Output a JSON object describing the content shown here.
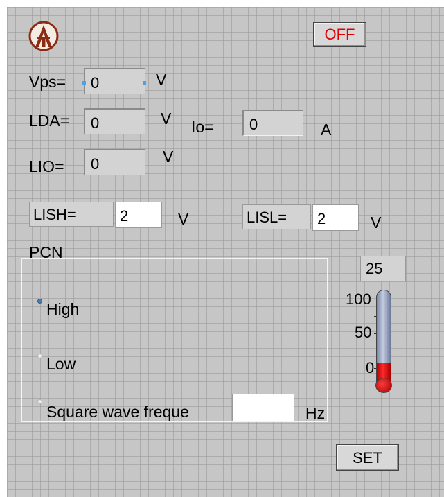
{
  "panel": {
    "power_button": "OFF",
    "vps": {
      "label": "Vps=",
      "value": "0",
      "unit": "V"
    },
    "lda": {
      "label": "LDA=",
      "value": "0",
      "unit": "V"
    },
    "io": {
      "label": "Io=",
      "value": "0",
      "unit": "A"
    },
    "lio": {
      "label": "LIO=",
      "value": "0",
      "unit": "V"
    },
    "lish": {
      "label": "LISH=",
      "value": "2",
      "unit": "V"
    },
    "lisl": {
      "label": "LISL=",
      "value": "2",
      "unit": "V"
    },
    "pcn": {
      "title": "PCN",
      "options": [
        "High",
        "Low",
        "Square wave freque"
      ],
      "selected": "High",
      "freq_value": "",
      "freq_unit": "Hz"
    },
    "thermometer": {
      "value_display": "25",
      "scale_labels": [
        "100",
        "50",
        "0"
      ],
      "min": 0,
      "max": 100,
      "fill_level": 0.26
    },
    "set_button": "SET"
  },
  "colors": {
    "panel_bg": "#c6c6c6",
    "off_text": "#e00000",
    "radio_on": "#4a7fb0",
    "thermo_fill": "#d00000",
    "thermo_tube": "#9aa4c0"
  },
  "icons": {
    "logo": "tower-logo-icon"
  }
}
